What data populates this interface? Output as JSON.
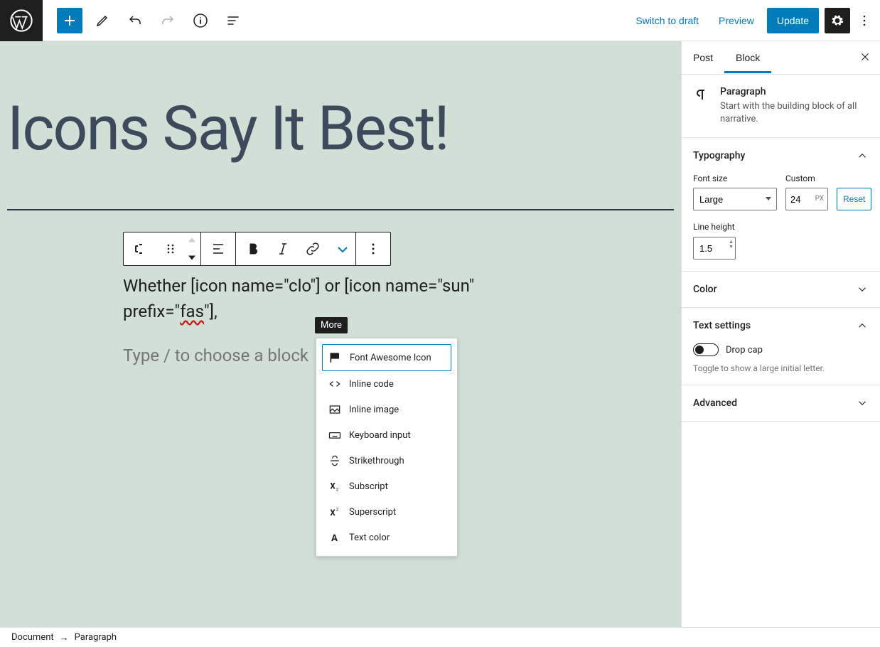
{
  "header": {
    "switch_to_draft": "Switch to draft",
    "preview": "Preview",
    "update": "Update"
  },
  "editor": {
    "page_title": "Icons Say It Best!",
    "paragraph_line1": "Whether [icon name=\"clo",
    "paragraph_line2_prefix": "\"] or [icon name=\"sun\" prefix=\"",
    "paragraph_underlined": "fas",
    "paragraph_suffix": "\"],",
    "placeholder": "Type / to choose a block",
    "tooltip": "More"
  },
  "dropdown": {
    "items": [
      "Font Awesome Icon",
      "Inline code",
      "Inline image",
      "Keyboard input",
      "Strikethrough",
      "Subscript",
      "Superscript",
      "Text color"
    ]
  },
  "sidebar": {
    "tabs": {
      "post": "Post",
      "block": "Block"
    },
    "block_info": {
      "title": "Paragraph",
      "description": "Start with the building block of all narrative."
    },
    "typography": {
      "title": "Typography",
      "font_size_label": "Font size",
      "font_size_value": "Large",
      "custom_label": "Custom",
      "custom_value": "24",
      "custom_unit": "PX",
      "reset": "Reset",
      "line_height_label": "Line height",
      "line_height_value": "1.5"
    },
    "color": {
      "title": "Color"
    },
    "text_settings": {
      "title": "Text settings",
      "drop_cap": "Drop cap",
      "drop_cap_desc": "Toggle to show a large initial letter."
    },
    "advanced": {
      "title": "Advanced"
    }
  },
  "breadcrumb": {
    "document": "Document",
    "arrow": "→",
    "current": "Paragraph"
  }
}
